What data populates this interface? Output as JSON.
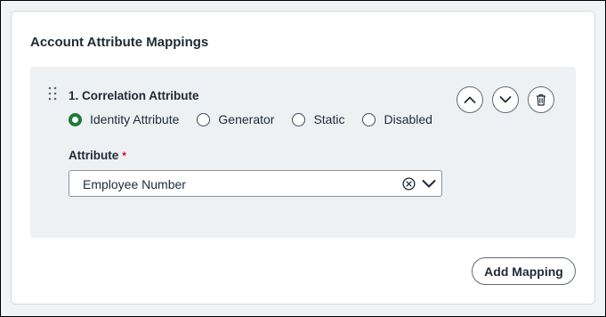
{
  "section": {
    "title": "Account Attribute Mappings"
  },
  "mapping": {
    "title": "1. Correlation Attribute",
    "types": [
      {
        "label": "Identity Attribute",
        "selected": true
      },
      {
        "label": "Generator",
        "selected": false
      },
      {
        "label": "Static",
        "selected": false
      },
      {
        "label": "Disabled",
        "selected": false
      }
    ],
    "attribute_label": "Attribute",
    "required_marker": "*",
    "attribute_value": "Employee Number",
    "actions": [
      "chevron-up-icon",
      "chevron-down-icon",
      "trash-icon"
    ]
  },
  "footer": {
    "add_label": "Add Mapping"
  },
  "colors": {
    "accent": "#1d7a3a",
    "required": "#c8102e",
    "panel": "#eef1f4"
  }
}
